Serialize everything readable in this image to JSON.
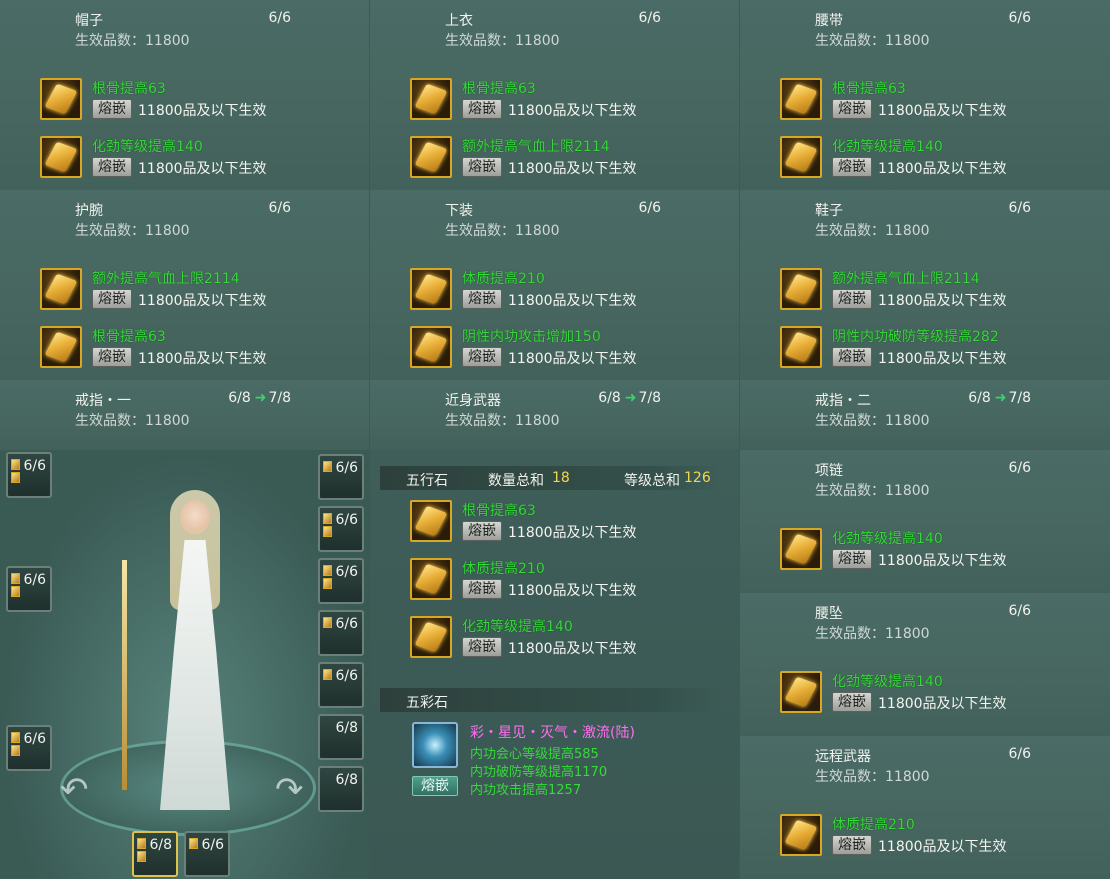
{
  "fuse_label": "熔嵌",
  "sub_label": "生效品数：",
  "equipment": [
    {
      "id": "hat",
      "title": "帽子",
      "count": "6/6",
      "grade": "11800",
      "gems": [
        {
          "name": "根骨提高63",
          "desc": "11800品及以下生效"
        },
        {
          "name": "化劲等级提高140",
          "desc": "11800品及以下生效"
        }
      ]
    },
    {
      "id": "top",
      "title": "上衣",
      "count": "6/6",
      "grade": "11800",
      "gems": [
        {
          "name": "根骨提高63",
          "desc": "11800品及以下生效"
        },
        {
          "name": "额外提高气血上限2114",
          "desc": "11800品及以下生效"
        }
      ]
    },
    {
      "id": "belt",
      "title": "腰带",
      "count": "6/6",
      "grade": "11800",
      "gems": [
        {
          "name": "根骨提高63",
          "desc": "11800品及以下生效"
        },
        {
          "name": "化劲等级提高140",
          "desc": "11800品及以下生效"
        }
      ]
    },
    {
      "id": "wrist",
      "title": "护腕",
      "count": "6/6",
      "grade": "11800",
      "gems": [
        {
          "name": "额外提高气血上限2114",
          "desc": "11800品及以下生效"
        },
        {
          "name": "根骨提高63",
          "desc": "11800品及以下生效"
        }
      ]
    },
    {
      "id": "pants",
      "title": "下装",
      "count": "6/6",
      "grade": "11800",
      "gems": [
        {
          "name": "体质提高210",
          "desc": "11800品及以下生效"
        },
        {
          "name": "阴性内功攻击增加150",
          "desc": "11800品及以下生效"
        }
      ]
    },
    {
      "id": "shoes",
      "title": "鞋子",
      "count": "6/6",
      "grade": "11800",
      "gems": [
        {
          "name": "额外提高气血上限2114",
          "desc": "11800品及以下生效"
        },
        {
          "name": "阴性内功破防等级提高282",
          "desc": "11800品及以下生效"
        }
      ]
    },
    {
      "id": "ring1",
      "title": "戒指・一",
      "count": "6/8",
      "next": "7/8",
      "grade": "11800",
      "gems": []
    },
    {
      "id": "melee",
      "title": "近身武器",
      "count": "6/8",
      "next": "7/8",
      "grade": "11800",
      "gems": []
    },
    {
      "id": "ring2",
      "title": "戒指・二",
      "count": "6/8",
      "next": "7/8",
      "grade": "11800",
      "gems": []
    },
    {
      "id": "necklace",
      "title": "项链",
      "count": "6/6",
      "grade": "11800",
      "gems": [
        {
          "name": "化劲等级提高140",
          "desc": "11800品及以下生效"
        }
      ]
    },
    {
      "id": "pendant",
      "title": "腰坠",
      "count": "6/6",
      "grade": "11800",
      "gems": [
        {
          "name": "化劲等级提高140",
          "desc": "11800品及以下生效"
        }
      ]
    },
    {
      "id": "ranged",
      "title": "远程武器",
      "count": "6/6",
      "grade": "11800",
      "gems": [
        {
          "name": "体质提高210",
          "desc": "11800品及以下生效"
        }
      ]
    }
  ],
  "five_elements": {
    "title": "五行石",
    "qty_label": "数量总和",
    "qty": "18",
    "level_label": "等级总和",
    "level": "126",
    "gems": [
      {
        "name": "根骨提高63",
        "desc": "11800品及以下生效"
      },
      {
        "name": "体质提高210",
        "desc": "11800品及以下生效"
      },
      {
        "name": "化劲等级提高140",
        "desc": "11800品及以下生效"
      }
    ]
  },
  "five_color": {
    "title": "五彩石",
    "name": "彩・星见・灭气・激流(陆)",
    "lines": [
      "内功会心等级提高585",
      "内功破防等级提高1170",
      "内功攻击提高1257"
    ],
    "button": "熔嵌"
  },
  "slots": {
    "left": [
      "6/6",
      "6/6",
      "6/6"
    ],
    "right": [
      "6/6",
      "6/6",
      "6/6",
      "6/6",
      "6/6",
      "6/8",
      "6/8"
    ],
    "bottom": [
      "6/8",
      "6/6"
    ]
  },
  "colors": {
    "gem_name": "#36d83a",
    "accent_number": "#f2d750",
    "arrow": "#3fd06a",
    "five_color_title": "#ff6ef0"
  }
}
